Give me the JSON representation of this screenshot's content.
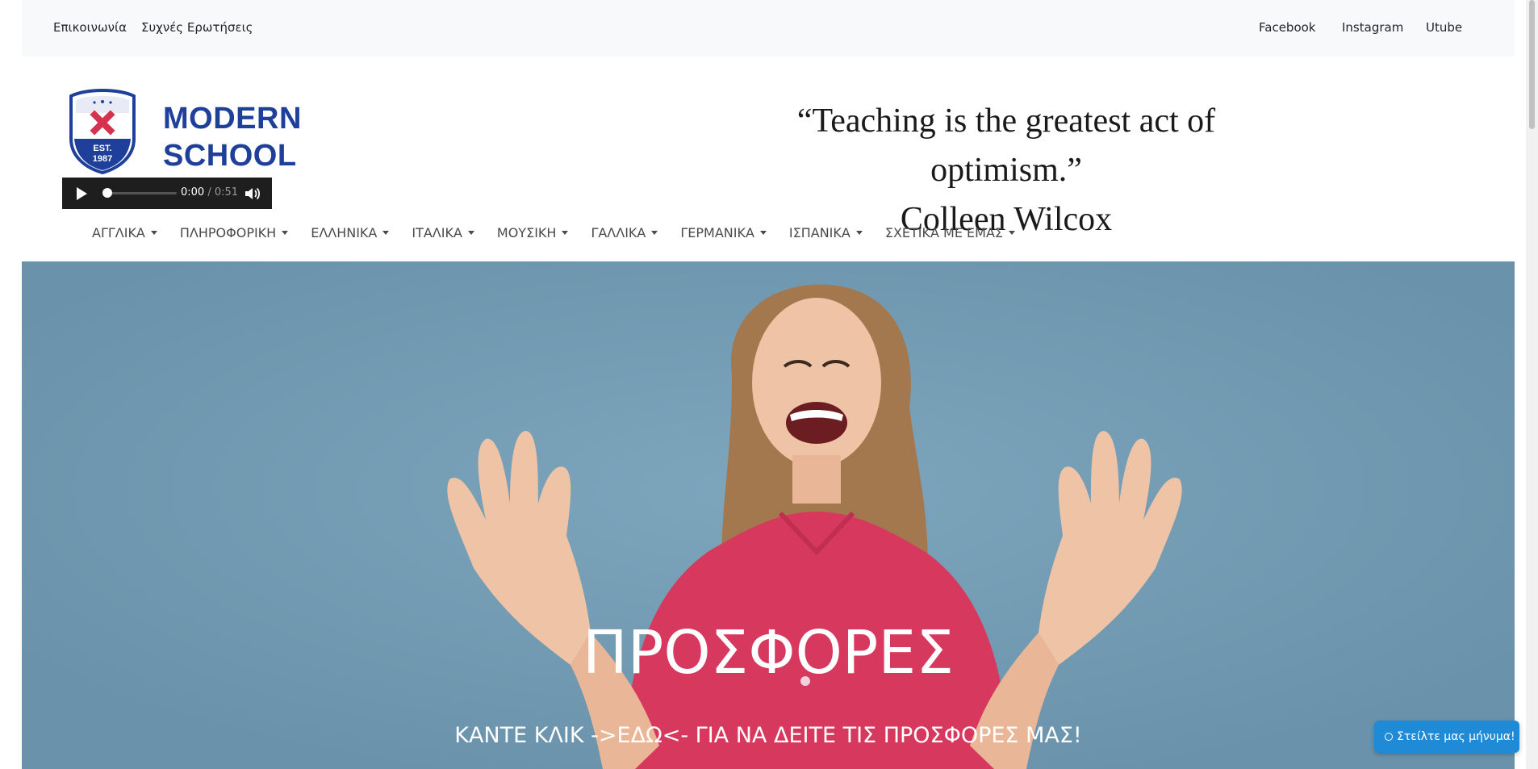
{
  "topbar": {
    "left_links": [
      "Επικοινωνία",
      "Συχνές Ερωτήσεις"
    ],
    "right_links": [
      "Facebook",
      "Instagram",
      "Utube"
    ]
  },
  "header": {
    "logo_text_line1": "MODERN",
    "logo_text_line2": "SCHOOL",
    "badge_line1": "EST.",
    "badge_line2": "1987",
    "quote_line1": "“Teaching is the greatest act of optimism.”",
    "quote_line2": "Colleen Wilcox"
  },
  "audio": {
    "current": "0:00",
    "duration": "0:51",
    "progress": 0
  },
  "nav": {
    "items": [
      "ΑΓΓΛΙΚΑ",
      "ΠΛΗΡΟΦΟΡΙΚΗ",
      "ΕΛΛΗΝΙΚΑ",
      "ΙΤΑΛΙΚΑ",
      "ΜΟΥΣΙΚΗ",
      "ΓΑΛΛΙΚΑ",
      "ΓΕΡΜΑΝΙΚΑ",
      "ΙΣΠΑΝΙΚΑ",
      "ΣΧΕΤΙΚΑ ΜΕ ΕΜΑΣ"
    ]
  },
  "hero": {
    "title": "ΠΡΟΣΦΟΡΕΣ",
    "subtitle": "ΚΑΝΤΕ ΚΛΙΚ ->ΕΔΩ<- ΓΙΑ ΝΑ ΔΕΙΤΕ ΤΙΣ ΠΡΟΣΦΟΡΕΣ ΜΑΣ!",
    "background_color": "#6f99b1"
  },
  "chat": {
    "label": "Στείλτε μας μήνυμα!"
  },
  "colors": {
    "brand": "#1e3f9a",
    "accent_red": "#d6324f",
    "chat_blue": "#1f8bd6"
  }
}
